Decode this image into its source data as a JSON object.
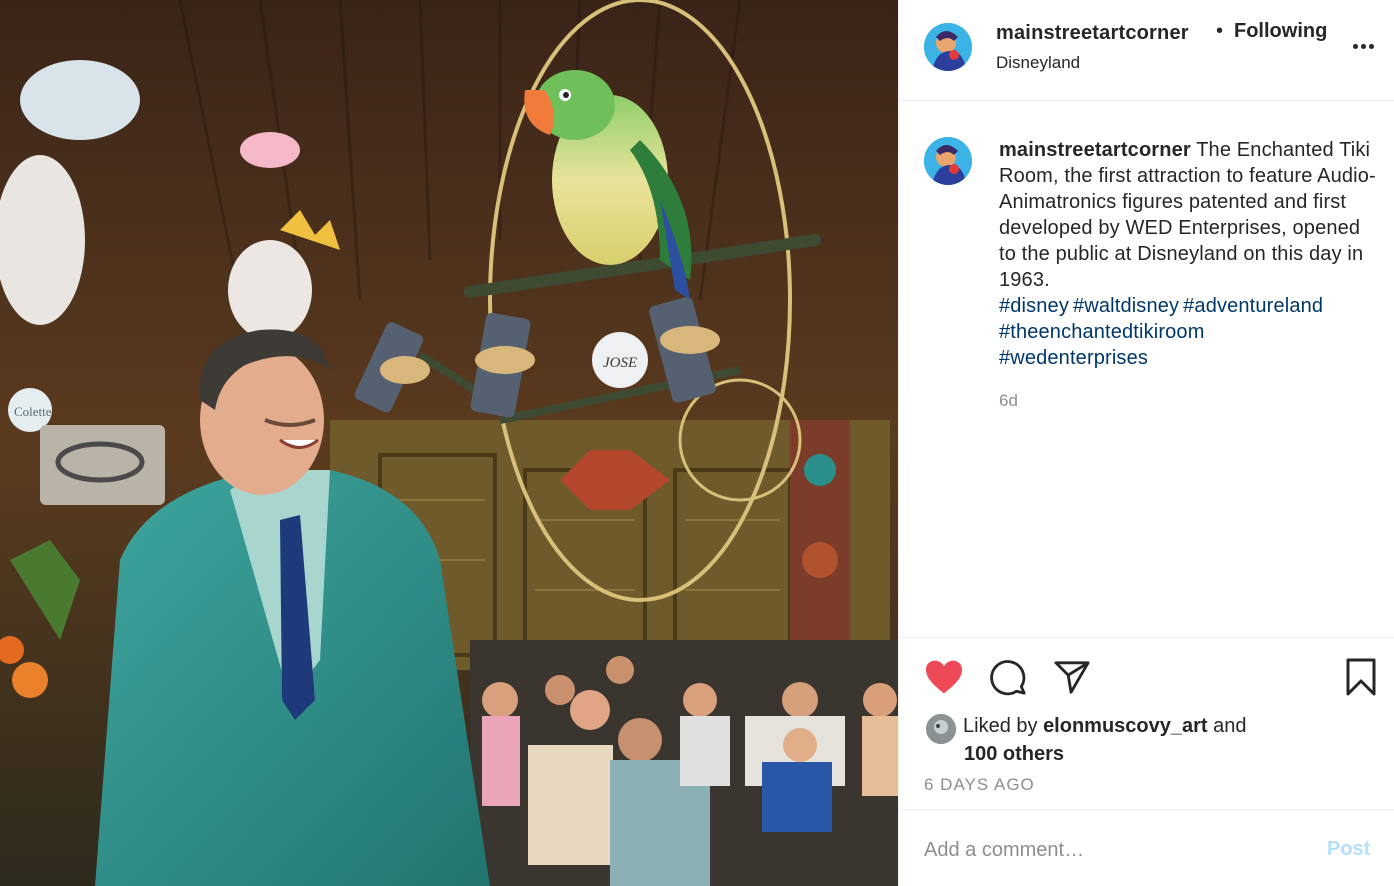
{
  "photo": {
    "subject": "photo",
    "perch_tag": "JOSE",
    "plaque_text": "Colette"
  },
  "header": {
    "username": "mainstreetartcorner",
    "separator": "•",
    "follow_label": "Following",
    "location": "Disneyland",
    "more_icon": "more-options-icon"
  },
  "caption": {
    "username": "mainstreetartcorner",
    "text": "The Enchanted Tiki Room, the first attraction to feature Audio-Animatronics figures patented and first developed by WED Enterprises, opened to the public at Disneyland on this day in 1963.",
    "hashtags": [
      "#disney",
      "#waltdisney",
      "#adventureland",
      "#theenchantedtikiroom",
      "#wedenterprises"
    ],
    "age": "6d"
  },
  "actions": {
    "like_icon": "heart-icon",
    "comment_icon": "comment-icon",
    "share_icon": "send-icon",
    "save_icon": "bookmark-icon",
    "liked_prefix": "Liked by",
    "liked_user": "elonmuscovy_art",
    "liked_and": "and",
    "liked_others": "100 others",
    "post_age": "6 DAYS AGO"
  },
  "comment": {
    "placeholder": "Add a comment…",
    "post_label": "Post"
  },
  "colors": {
    "like_red": "#ed4956",
    "hashtag_blue": "#00376b",
    "post_disabled": "#b2dffc",
    "muted_gray": "#8e8e8e"
  }
}
